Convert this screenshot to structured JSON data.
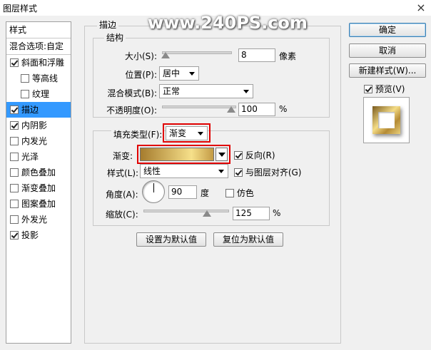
{
  "window": {
    "title": "图层样式",
    "close_glyph": "×"
  },
  "watermark": "www.240PS.com",
  "styles_list": {
    "header": "样式",
    "blend_options": "混合选项:自定",
    "items": [
      {
        "label": "斜面和浮雕",
        "checked": true
      },
      {
        "label": "等高线",
        "checked": false,
        "indent": true
      },
      {
        "label": "纹理",
        "checked": false,
        "indent": true
      },
      {
        "label": "描边",
        "checked": true,
        "selected": true
      },
      {
        "label": "内阴影",
        "checked": true
      },
      {
        "label": "内发光",
        "checked": false
      },
      {
        "label": "光泽",
        "checked": false
      },
      {
        "label": "颜色叠加",
        "checked": false
      },
      {
        "label": "渐变叠加",
        "checked": false
      },
      {
        "label": "图案叠加",
        "checked": false
      },
      {
        "label": "外发光",
        "checked": false
      },
      {
        "label": "投影",
        "checked": true
      }
    ]
  },
  "stroke": {
    "group_title": "描边",
    "structure": {
      "title": "结构",
      "size_label": "大小(S):",
      "size_value": "8",
      "size_unit": "像素",
      "position_label": "位置(P):",
      "position_value": "居中",
      "blend_label": "混合模式(B):",
      "blend_value": "正常",
      "opacity_label": "不透明度(O):",
      "opacity_value": "100",
      "opacity_unit": "%"
    },
    "fill": {
      "type_label": "填充类型(F):",
      "type_value": "渐变",
      "gradient_label": "渐变:",
      "reverse_label": "反向(R)",
      "reverse_checked": true,
      "style_label": "样式(L):",
      "style_value": "线性",
      "align_label": "与图层对齐(G)",
      "align_checked": true,
      "angle_label": "角度(A):",
      "angle_value": "90",
      "angle_unit": "度",
      "dither_label": "仿色",
      "dither_checked": false,
      "scale_label": "缩放(C):",
      "scale_value": "125",
      "scale_unit": "%"
    },
    "set_default": "设置为默认值",
    "reset_default": "复位为默认值"
  },
  "buttons": {
    "ok": "确定",
    "cancel": "取消",
    "new_style": "新建样式(W)..."
  },
  "preview": {
    "label": "预览(V)",
    "checked": true
  },
  "colors": {
    "selection": "#3399ff",
    "highlight_box": "#e00000",
    "gradient": [
      "#a67c2e",
      "#f6e08a",
      "#c39a45"
    ]
  }
}
